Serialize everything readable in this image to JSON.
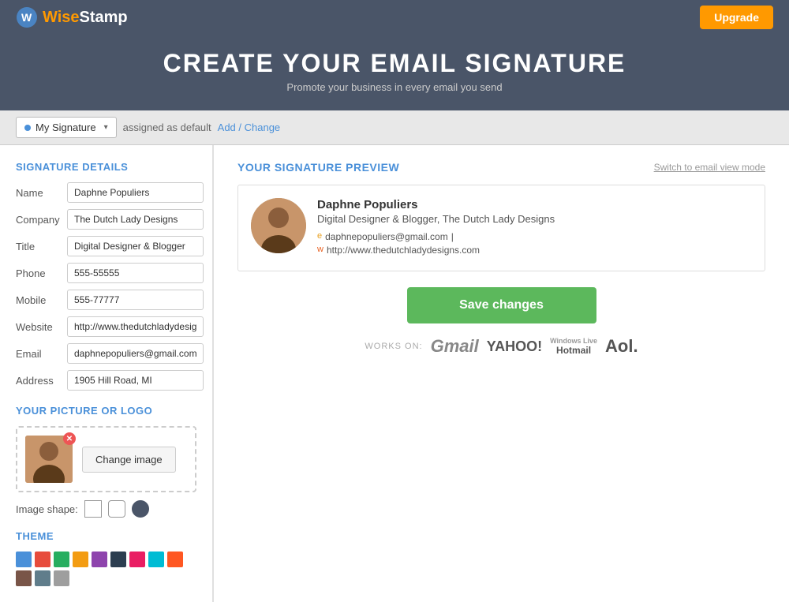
{
  "header": {
    "logo_wise": "Wise",
    "logo_stamp": "Stamp",
    "upgrade_label": "Upgrade"
  },
  "hero": {
    "title": "CREATE YOUR EMAIL SIGNATURE",
    "subtitle": "Promote your business in every email you send"
  },
  "toolbar": {
    "signature_name": "My Signature",
    "assigned_text": "assigned as default",
    "add_change_label": "Add / Change"
  },
  "signature_details": {
    "section_title": "SIGNATURE DETAILS",
    "fields": [
      {
        "label": "Name",
        "value": "Daphne Populiers",
        "placeholder": ""
      },
      {
        "label": "Company",
        "value": "The Dutch Lady Designs",
        "placeholder": ""
      },
      {
        "label": "Title",
        "value": "Digital Designer & Blogger",
        "placeholder": ""
      },
      {
        "label": "Phone",
        "value": "555-55555",
        "placeholder": ""
      },
      {
        "label": "Mobile",
        "value": "555-77777",
        "placeholder": ""
      },
      {
        "label": "Website",
        "value": "http://www.thedutchladydesigns.c",
        "placeholder": ""
      },
      {
        "label": "Email",
        "value": "daphnepopuliers@gmail.com",
        "placeholder": ""
      },
      {
        "label": "Address",
        "value": "1905 Hill Road, MI",
        "placeholder": ""
      }
    ]
  },
  "picture_section": {
    "title": "YOUR PICTURE OR LOGO",
    "change_image_label": "Change image",
    "image_shape_label": "Image shape:"
  },
  "theme_section": {
    "title": "THEME",
    "colors": [
      "#4a90d9",
      "#e74c3c",
      "#27ae60",
      "#f39c12",
      "#8e44ad",
      "#2c3e50",
      "#e91e63",
      "#00bcd4",
      "#ff5722",
      "#795548",
      "#607d8b",
      "#9e9e9e"
    ]
  },
  "preview": {
    "title": "YOUR SIGNATURE PREVIEW",
    "switch_label": "Switch to email view mode",
    "sig_name": "Daphne Populiers",
    "sig_title": "Digital Designer & Blogger, The Dutch Lady Designs",
    "sig_email": "daphnepopuliers@gmail.com",
    "sig_email_sep": " |",
    "sig_website": "http://www.thedutchladydesigns.com"
  },
  "save_button": {
    "label": "Save changes"
  },
  "works_on": {
    "label": "WORKS ON:",
    "services": [
      "Gmail",
      "YAHOO!",
      "Hotmail",
      "Aol."
    ]
  }
}
